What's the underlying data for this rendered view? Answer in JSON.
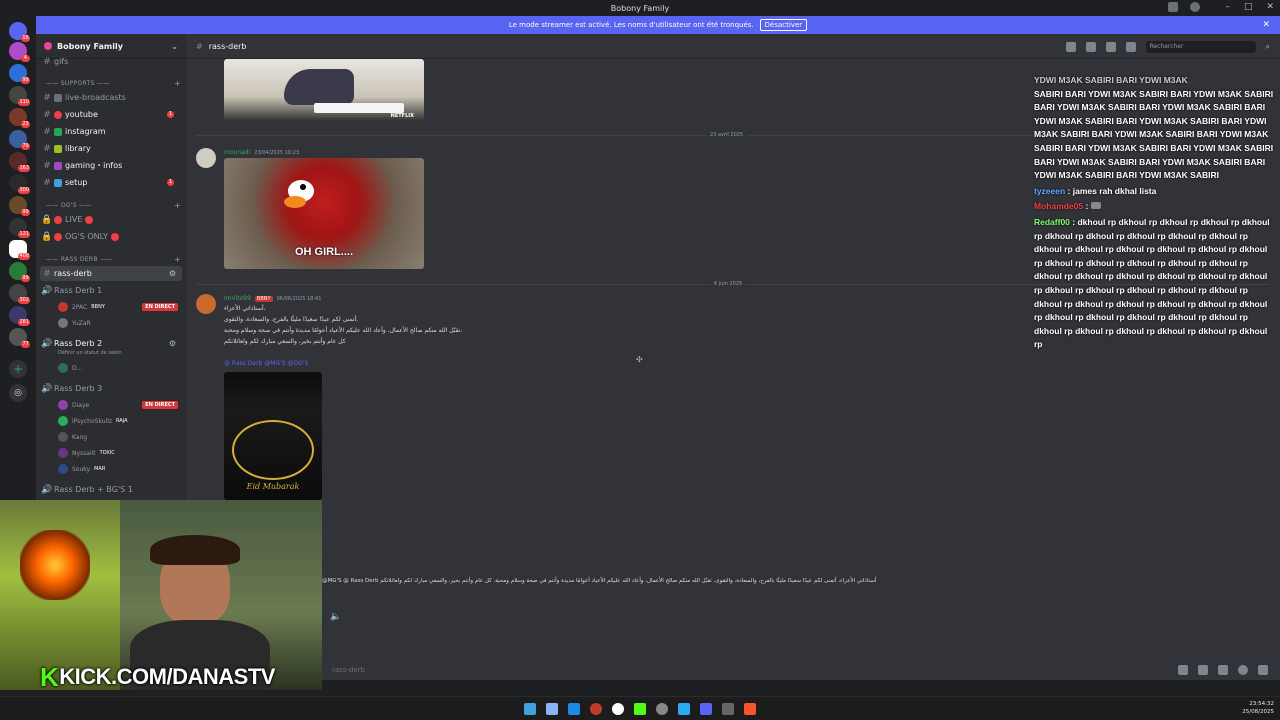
{
  "window": {
    "title": "Bobony Family"
  },
  "banner": {
    "text": "Le mode streamer est activé. Les noms d'utilisateur ont été tronqués.",
    "button": "Désactiver"
  },
  "server": {
    "name": "Bobony Family"
  },
  "sidebar": {
    "top_channel": "gifs",
    "cat_supports": "SUPPORTS",
    "cat_ogs": "OG'S",
    "cat_rassderb": "RASS DERB",
    "channels": [
      {
        "label": "live-broadcasts"
      },
      {
        "label": "youtube"
      },
      {
        "label": "instagram"
      },
      {
        "label": "library"
      },
      {
        "label": "gaming・infos"
      },
      {
        "label": "setup"
      },
      {
        "label": "LIVE"
      },
      {
        "label": "OG'S ONLY"
      },
      {
        "label": "rass-derb"
      }
    ],
    "voice": [
      {
        "label": "Rass Derb 1"
      },
      {
        "label": "Rass Derb 2"
      },
      {
        "label": "Rass Derb 3"
      },
      {
        "label": "Rass Derb + BG'S 1"
      }
    ],
    "status_hint": "Définir un statut de salon",
    "users1": [
      {
        "name": "2PAC",
        "tag": "BBNY",
        "live": "EN DIRECT"
      },
      {
        "name": "YuZaR"
      }
    ],
    "users2": [
      {
        "name": "D..."
      }
    ],
    "users3": [
      {
        "name": "Diaye",
        "live": "EN DIRECT"
      },
      {
        "name": "iPsychoSkullz",
        "tag": "RAJA"
      },
      {
        "name": "Kang"
      },
      {
        "name": "Nyssaiit",
        "tag": "TOXIC"
      },
      {
        "name": "Souky",
        "tag": "MAR"
      }
    ]
  },
  "header": {
    "channel": "rass-derb",
    "search_placeholder": "Rechercher"
  },
  "chat": {
    "date1": "23 avril 2025",
    "msg1_user": "mounadi",
    "msg1_time": "23/04/2025 10:23",
    "gif1_caption": "OH GIRL....",
    "gif_top_label": "NETFLIX",
    "date2": "6 juin 2025",
    "msg2_user": "ImVito99",
    "msg2_tag": "BBNY",
    "msg2_time": "06/06/2025 18:41",
    "msg2_lines": [
      "أستاذاتي الأعزاء،",
      "أتمنى لكم عيدًا سعيدًا مليئًا بالفرح، والسعادة، والتقوى.",
      "تقبّل الله منكم صالح الأعمال، وأعاد الله عليكم الأعياد أعوامًا مديدة وأنتم في صحة وسلام ومحبة.",
      "كل عام وأنتم بخير، والسعي مبارك لكم ولعائلاتكم"
    ],
    "mentions": "@ Rass Derb @MG'S @OG'S",
    "card_text": "Eid Mubarak"
  },
  "overlay": {
    "lines": [
      "YDWI M3AK SABIRI BARI YDWI M3AK",
      "SABIRI BARI YDWI M3AK SABIRI BARI YDWI M3AK SABIRI BARI YDWI M3AK SABIRI BARI YDWI M3AK SABIRI BARI YDWI M3AK SABIRI BARI YDWI M3AK SABIRI BARI YDWI M3AK SABIRI BARI YDWI M3AK SABIRI BARI YDWI M3AK SABIRI BARI YDWI M3AK SABIRI BARI YDWI M3AK SABIRI BARI YDWI M3AK SABIRI BARI YDWI M3AK SABIRI BARI YDWI M3AK SABIRI BARI YDWI M3AK SABIRI"
    ],
    "msg2_name": "tyzeeen",
    "msg2_text": " : james rah dkhal lista",
    "msg3_name": "Mohamde05",
    "msg3_text": " : ",
    "msg4_name": "Redaff00",
    "msg4_text": " : dkhoul rp dkhoul rp dkhoul rp dkhoul rp dkhoul rp dkhoul rp dkhoul rp dkhoul rp dkhoul rp dkhoul rp dkhoul rp dkhoul rp dkhoul rp dkhoul rp dkhoul rp dkhoul rp dkhoul rp dkhoul rp dkhoul rp dkhoul rp dkhoul rp dkhoul rp dkhoul rp dkhoul rp dkhoul rp dkhoul rp dkhoul rp dkhoul rp dkhoul rp dkhoul rp dkhoul rp dkhoul rp dkhoul rp dkhoul rp dkhoul rp dkhoul rp dkhoul rp dkhoul rp dkhoul rp dkhoul rp dkhoul rp dkhoul rp dkhoul rp dkhoul rp dkhoul rp dkhoul rp dkhoul rp dkhoul rp dkhoul rp"
  },
  "reply": {
    "text": "@MG'S @ Rass Derb  أستاذاتي الأعزاء، أتمنى لكم عيدًا سعيدًا مليئًا بالفرح، والسعادة، والتقوى. تقبّل الله منكم صالح الأعمال، وأعاد الله عليكم الأعياد أعوامًا مديدة وأنتم في صحة وسلام ومحبة. كل عام وأنتم بخير، والسعي مبارك لكم ولعائلاتكم"
  },
  "input": {
    "placeholder": "rass-derb"
  },
  "webcam": {
    "brand_k": "K",
    "brand": "KICK.COM/DANASTV"
  },
  "taskbar": {
    "time": "23:54:32",
    "date": "25/08/2025"
  },
  "colors": {
    "accent": "#5865f2",
    "live": "#da373c",
    "kick": "#53fc18"
  }
}
